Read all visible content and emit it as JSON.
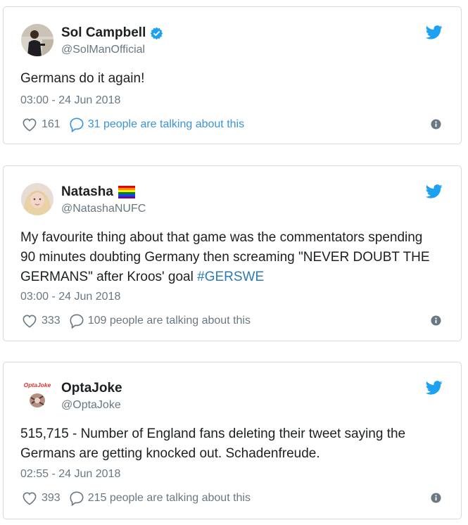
{
  "colors": {
    "link": "#2b7bb9",
    "muted": "#697882",
    "twitter_blue": "#1da1f2",
    "verified": "#1da1f2"
  },
  "tweets": [
    {
      "name": "Sol Campbell",
      "handle": "@SolManOfficial",
      "verified": true,
      "text": "Germans do it again!",
      "time": "03:00 - 24 Jun 2018",
      "likes": "161",
      "talking": "31 people are talking about this"
    },
    {
      "name": "Natasha",
      "handle": "@NatashaNUFC",
      "badge": "rainbow-flag-icon",
      "text": "My favourite thing about that game was the commentators spending 90 minutes doubting Germany then screaming \"NEVER DOUBT THE GERMANS\" after Kroos' goal",
      "hashtag": "#GERSWE",
      "time": "03:00 - 24 Jun 2018",
      "likes": "333",
      "talking": "109 people are talking about this"
    },
    {
      "name": "OptaJoke",
      "handle": "@OptaJoke",
      "avatar_text": "OptaJoke",
      "text": "515,715 - Number of England fans deleting their tweet saying the Germans are getting knocked out. Schadenfreude.",
      "time": "02:55 - 24 Jun 2018",
      "likes": "393",
      "talking": "215 people are talking about this"
    }
  ]
}
